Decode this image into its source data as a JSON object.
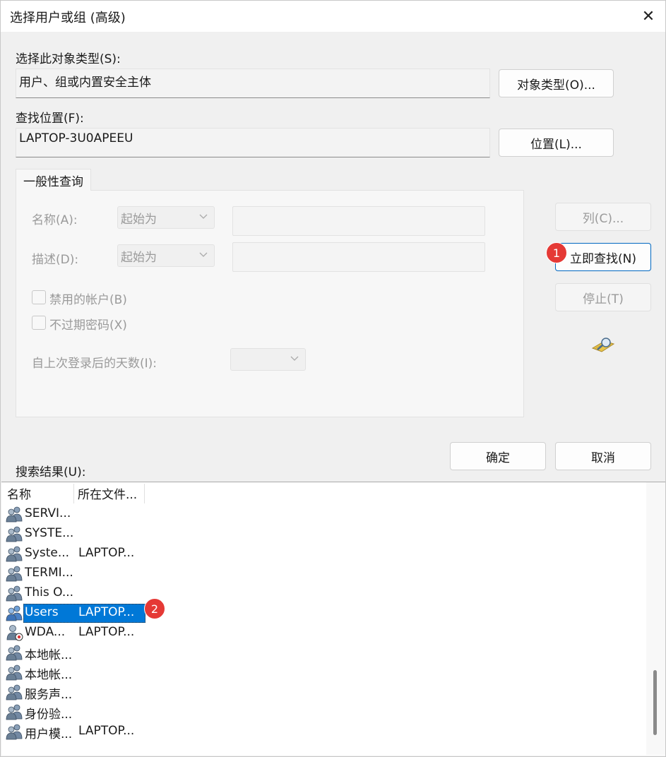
{
  "window": {
    "title": "选择用户或组 (高级)",
    "close_glyph": "✕"
  },
  "object_type": {
    "label": "选择此对象类型(S):",
    "value": "用户、组或内置安全主体",
    "button": "对象类型(O)..."
  },
  "location": {
    "label": "查找位置(F):",
    "value": "LAPTOP-3U0APEEU",
    "button": "位置(L)..."
  },
  "query": {
    "tab": "一般性查询",
    "name_label": "名称(A):",
    "name_mode": "起始为",
    "desc_label": "描述(D):",
    "desc_mode": "起始为",
    "disabled_accounts": "禁用的帐户(B)",
    "no_expire_password": "不过期密码(X)",
    "days_since_login": "自上次登录后的天数(I):"
  },
  "side_buttons": {
    "columns": "列(C)...",
    "find_now": "立即查找(N)",
    "stop": "停止(T)"
  },
  "dialog_buttons": {
    "ok": "确定",
    "cancel": "取消"
  },
  "annotations": {
    "badge1": "1",
    "badge2": "2",
    "badge_color": "#e53935"
  },
  "results": {
    "label": "搜索结果(U):",
    "columns": [
      "名称",
      "所在文件..."
    ],
    "rows": [
      {
        "name": "SERVI...",
        "folder": ""
      },
      {
        "name": "SYSTE...",
        "folder": ""
      },
      {
        "name": "Syste...",
        "folder": "LAPTOP..."
      },
      {
        "name": "TERMI...",
        "folder": ""
      },
      {
        "name": "This O...",
        "folder": ""
      },
      {
        "name": "Users",
        "folder": "LAPTOP..."
      },
      {
        "name": "WDA...",
        "folder": "LAPTOP..."
      },
      {
        "name": "本地帐...",
        "folder": ""
      },
      {
        "name": "本地帐...",
        "folder": ""
      },
      {
        "name": "服务声...",
        "folder": ""
      },
      {
        "name": "身份验...",
        "folder": ""
      },
      {
        "name": "用户模...",
        "folder": "LAPTOP..."
      }
    ],
    "selected_index": 5
  },
  "colors": {
    "selection": "#0078d7",
    "accent_border": "#0067c0"
  }
}
